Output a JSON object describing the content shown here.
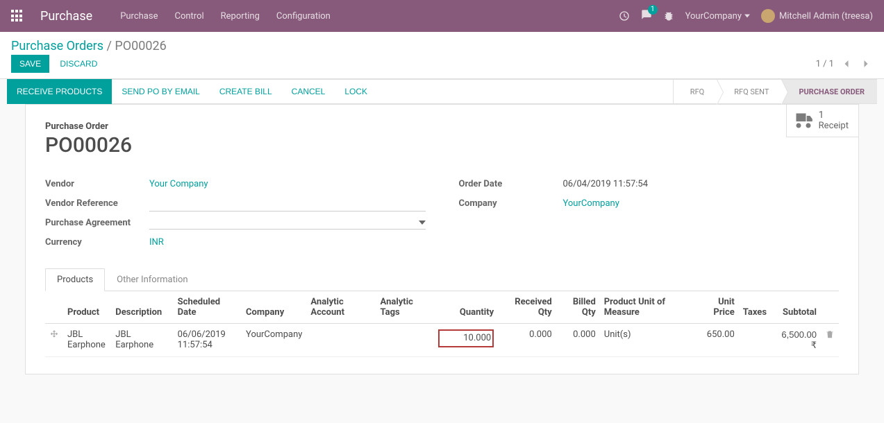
{
  "app_title": "Purchase",
  "nav": [
    "Purchase",
    "Control",
    "Reporting",
    "Configuration"
  ],
  "messages_badge": "1",
  "company_switch": "YourCompany",
  "user_name": "Mitchell Admin (treesa)",
  "breadcrumb": {
    "root": "Purchase Orders",
    "current": "PO00026"
  },
  "form_buttons": {
    "save": "SAVE",
    "discard": "DISCARD"
  },
  "pager": {
    "text": "1 / 1"
  },
  "statusbar_buttons": [
    "RECEIVE PRODUCTS",
    "SEND PO BY EMAIL",
    "CREATE BILL",
    "CANCEL",
    "LOCK"
  ],
  "status_steps": [
    {
      "label": "RFQ",
      "active": false
    },
    {
      "label": "RFQ SENT",
      "active": false
    },
    {
      "label": "PURCHASE ORDER",
      "active": true
    }
  ],
  "stat": {
    "count": "1",
    "label": "Receipt"
  },
  "title": {
    "label": "Purchase Order",
    "value": "PO00026"
  },
  "left_fields": [
    {
      "label": "Vendor",
      "value": "Your Company",
      "type": "link"
    },
    {
      "label": "Vendor Reference",
      "value": "",
      "type": "input"
    },
    {
      "label": "Purchase Agreement",
      "value": "",
      "type": "dropdown"
    },
    {
      "label": "Currency",
      "value": "INR",
      "type": "link"
    }
  ],
  "right_fields": [
    {
      "label": "Order Date",
      "value": "06/04/2019 11:57:54",
      "type": "text"
    },
    {
      "label": "Company",
      "value": "YourCompany",
      "type": "link"
    }
  ],
  "tabs": [
    "Products",
    "Other Information"
  ],
  "active_tab": 0,
  "table": {
    "headers": [
      "Product",
      "Description",
      "Scheduled Date",
      "Company",
      "Analytic Account",
      "Analytic Tags",
      "Quantity",
      "Received Qty",
      "Billed Qty",
      "Product Unit of Measure",
      "Unit Price",
      "Taxes",
      "Subtotal"
    ],
    "row": {
      "product": "JBL Earphone",
      "description": "JBL Earphone",
      "scheduled_date": "06/06/2019 11:57:54",
      "company": "YourCompany",
      "analytic_account": "",
      "analytic_tags": "",
      "quantity": "10.000",
      "received_qty": "0.000",
      "billed_qty": "0.000",
      "uom": "Unit(s)",
      "unit_price": "650.00",
      "taxes": "",
      "subtotal": "6,500.00 ₹"
    }
  }
}
